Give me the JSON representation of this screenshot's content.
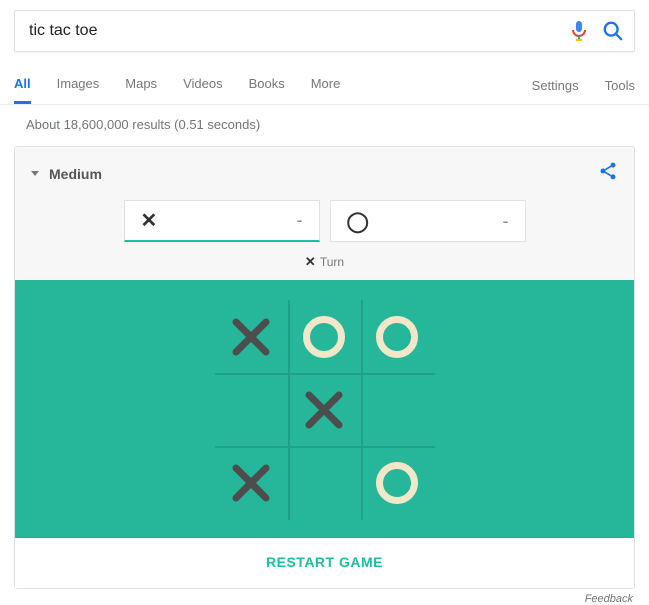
{
  "search": {
    "query": "tic tac toe"
  },
  "tabs": {
    "items": [
      "All",
      "Images",
      "Maps",
      "Videos",
      "Books",
      "More"
    ],
    "right": [
      "Settings",
      "Tools"
    ],
    "active_index": 0
  },
  "stats": "About 18,600,000 results (0.51 seconds)",
  "game": {
    "difficulty": "Medium",
    "score": {
      "x": "-",
      "o": "-"
    },
    "turn_mark": "✕",
    "turn_label": "Turn",
    "restart": "RESTART GAME",
    "board": [
      [
        "X",
        "O",
        "O"
      ],
      [
        "",
        "X",
        ""
      ],
      [
        "X",
        "",
        "O"
      ]
    ]
  },
  "feedback": "Feedback",
  "colors": {
    "accent": "#1a73e8",
    "board": "#26b79a",
    "x": "#4d4d4d",
    "o": "#f2e8c9"
  }
}
